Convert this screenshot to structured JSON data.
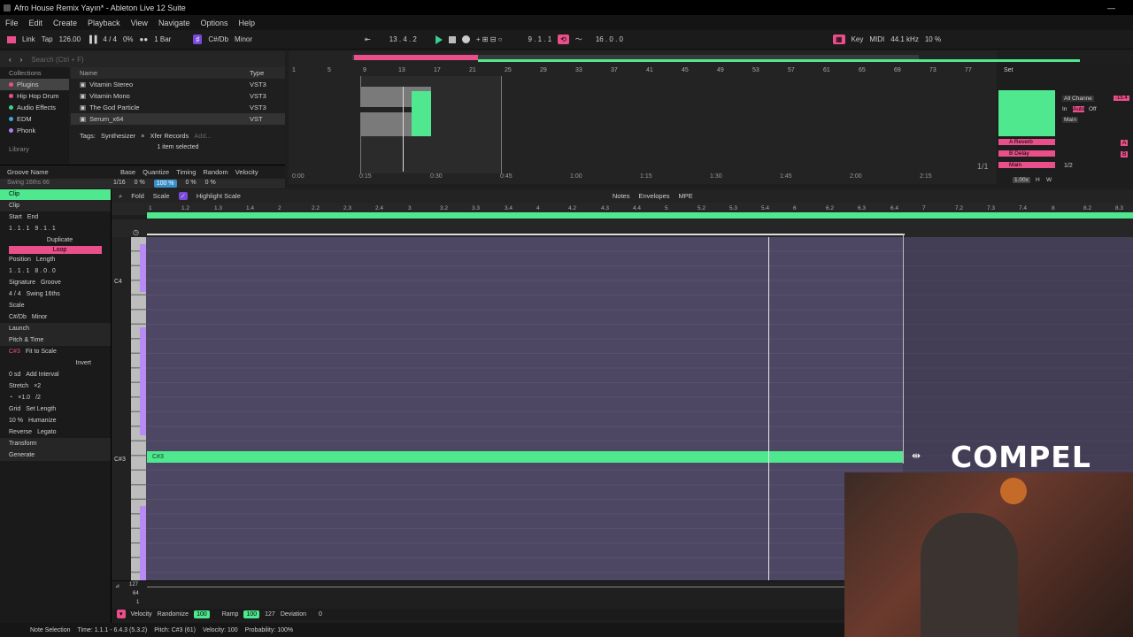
{
  "window": {
    "title": "Afro House Remix Yayın* - Ableton Live 12 Suite"
  },
  "menu": [
    "File",
    "Edit",
    "Create",
    "Playback",
    "View",
    "Navigate",
    "Options",
    "Help"
  ],
  "control": {
    "link": "Link",
    "tap": "Tap",
    "tempo": "126.00",
    "signature": "4 / 4",
    "metronome_pct": "0%",
    "quantize": "1 Bar",
    "key": "C#/Db",
    "scale": "Minor",
    "position": "13 . 4 . 2",
    "loop_start": "9 . 1 . 1",
    "loop_length": "16 . 0 . 0",
    "key_label": "Key",
    "midi_label": "MIDI",
    "sample_rate": "44.1 kHz",
    "cpu": "10 %"
  },
  "browser": {
    "search_placeholder": "Search (Ctrl + F)",
    "collections_header": "Collections",
    "name_header": "Name",
    "type_header": "Type",
    "collections": [
      {
        "label": "Plugins",
        "color": "#e94f8a"
      },
      {
        "label": "Hip Hop Drum",
        "color": "#e94f8a"
      },
      {
        "label": "Audio Effects",
        "color": "#3ad28a"
      },
      {
        "label": "EDM",
        "color": "#3aa6e0"
      },
      {
        "label": "Phonk",
        "color": "#b07cf0"
      }
    ],
    "library_label": "Library",
    "items": [
      {
        "name": "Vitamin Stereo",
        "type": "VST3"
      },
      {
        "name": "Vitamin Mono",
        "type": "VST3"
      },
      {
        "name": "The God Particle",
        "type": "VST3"
      },
      {
        "name": "Serum_x64",
        "type": "VST"
      }
    ],
    "tags_label": "Tags:",
    "tags": [
      "Synthesizer",
      "Xfer Records"
    ],
    "add_label": "Add...",
    "selection": "1 item selected"
  },
  "groove": {
    "headers": [
      "Groove Name",
      "Base",
      "Quantize",
      "Timing",
      "Random",
      "Velocity"
    ],
    "row": {
      "name": "Swing 16ths 66",
      "base": "1/16",
      "quantize": "0 %",
      "timing": "100 %",
      "random": "0 %",
      "velocity": "0 %"
    }
  },
  "arrangement": {
    "ruler": [
      "1",
      "5",
      "9",
      "13",
      "17",
      "21",
      "25",
      "29",
      "33",
      "37",
      "41",
      "45",
      "49",
      "53",
      "57",
      "61",
      "65",
      "69",
      "73",
      "77"
    ],
    "times": [
      "0:00",
      "0:15",
      "0:30",
      "0:45",
      "1:00",
      "1:15",
      "1:30",
      "1:45",
      "2:00",
      "2:15"
    ],
    "page": "1/1"
  },
  "mixer": {
    "input": "All Channe",
    "in": "In",
    "auto": "Auto",
    "off": "Off",
    "main": "Main",
    "sends": [
      "A Reverb",
      "B Delay",
      "Main"
    ],
    "send_letters": [
      "A",
      "B"
    ],
    "fraction": "1/2",
    "speed": "1.00x",
    "hbtn": "H",
    "wbtn": "W",
    "level": "-15.4",
    "set": "Set"
  },
  "clip": {
    "header": "Clip",
    "section": "Clip",
    "start_label": "Start",
    "end_label": "End",
    "set_label": "Set",
    "start": "1 . 1 . 1",
    "end": "9 . 1 . 1",
    "duplicate": "Duplicate",
    "loop": "Loop",
    "position_label": "Position",
    "length_label": "Length",
    "position": "1 . 1 . 1",
    "length": "8 . 0 . 0",
    "signature_label": "Signature",
    "groove_label": "Groove",
    "signature": "4 / 4",
    "groove": "Swing 16ths",
    "scale_label": "Scale",
    "scale_key": "C#/Db",
    "scale_mode": "Minor",
    "launch": "Launch",
    "pitch_time": "Pitch & Time",
    "key_display": "C#3",
    "fit_to_scale": "Fit to Scale",
    "invert": "Invert",
    "semitones": "0 sd",
    "add_interval": "Add Interval",
    "stretch": "Stretch",
    "x2": "×2",
    "div2": "/2",
    "stretch_val": "×1.0",
    "grid_label": "Grid",
    "set_length": "Set Length",
    "humanize_pct": "10 %",
    "humanize": "Humanize",
    "reverse": "Reverse",
    "legato": "Legato",
    "transform": "Transform",
    "generate": "Generate"
  },
  "piano": {
    "fold": "Fold",
    "scale": "Scale",
    "highlight": "Highlight Scale",
    "tabs": [
      "Notes",
      "Envelopes",
      "MPE"
    ],
    "beats": [
      "1",
      "1.2",
      "1.3",
      "1.4",
      "2",
      "2.2",
      "2.3",
      "2.4",
      "3",
      "3.2",
      "3.3",
      "3.4",
      "4",
      "4.2",
      "4.3",
      "4.4",
      "5",
      "5.2",
      "5.3",
      "5.4",
      "6",
      "6.2",
      "6.3",
      "6.4",
      "7",
      "7.2",
      "7.3",
      "7.4",
      "8",
      "8.2",
      "8.3"
    ],
    "key_c4": "C4",
    "key_c3": "C#3",
    "note_label": "C#3"
  },
  "velocity": {
    "label": "Velocity",
    "randomize": "Randomize",
    "rand_val": "100",
    "ramp": "Ramp",
    "ramp_val": "100",
    "val127": "127",
    "deviation": "Deviation",
    "dev_val": "0",
    "scale_top": "127",
    "scale_mid": "64",
    "scale_bot": "1"
  },
  "status": {
    "mode": "Note Selection",
    "time": "Time: 1.1.1 - 6.4.3 (5.3.2)",
    "pitch": "Pitch: C#3 (61)",
    "velocity": "Velocity: 100",
    "probability": "Probability: 100%"
  },
  "overlay": {
    "brand": "COMPEL"
  }
}
